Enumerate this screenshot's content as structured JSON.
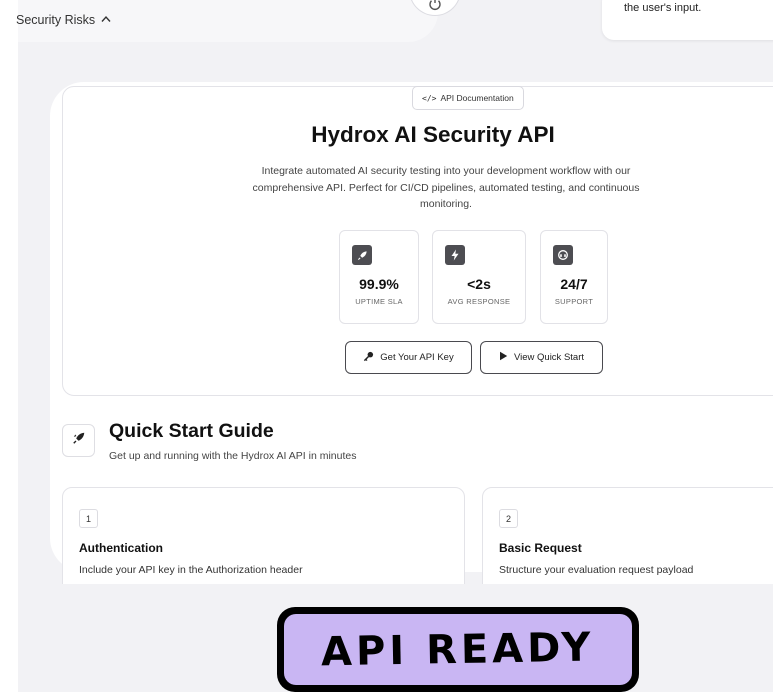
{
  "topbar": {
    "risk_label": "Security Risks",
    "info_text": "the user's input."
  },
  "hero": {
    "badge_label": "API Documentation",
    "title": "Hydrox AI Security API",
    "description": "Integrate automated AI security testing into your development workflow with our comprehensive API. Perfect for CI/CD pipelines, automated testing, and continuous monitoring.",
    "stats": [
      {
        "icon": "rocket-icon",
        "value": "99.9%",
        "label": "UPTIME SLA"
      },
      {
        "icon": "lightning-icon",
        "value": "<2s",
        "label": "AVG RESPONSE"
      },
      {
        "icon": "headset-icon",
        "value": "24/7",
        "label": "SUPPORT"
      }
    ],
    "buttons": {
      "api_key": "Get Your API Key",
      "quick_start": "View Quick Start"
    }
  },
  "quick_start": {
    "title": "Quick Start Guide",
    "subtitle": "Get up and running with the Hydrox AI API in minutes",
    "steps": [
      {
        "number": "1",
        "title": "Authentication",
        "description": "Include your API key in the Authorization header"
      },
      {
        "number": "2",
        "title": "Basic Request",
        "description": "Structure your evaluation request payload"
      }
    ]
  },
  "overlay": {
    "badge_text": "API READY",
    "badge_color": "#c9b6f3"
  },
  "colors": {
    "background": "#f2f2f5",
    "card": "#ffffff",
    "icon_tile": "#4d4d52",
    "text": "#111111"
  }
}
